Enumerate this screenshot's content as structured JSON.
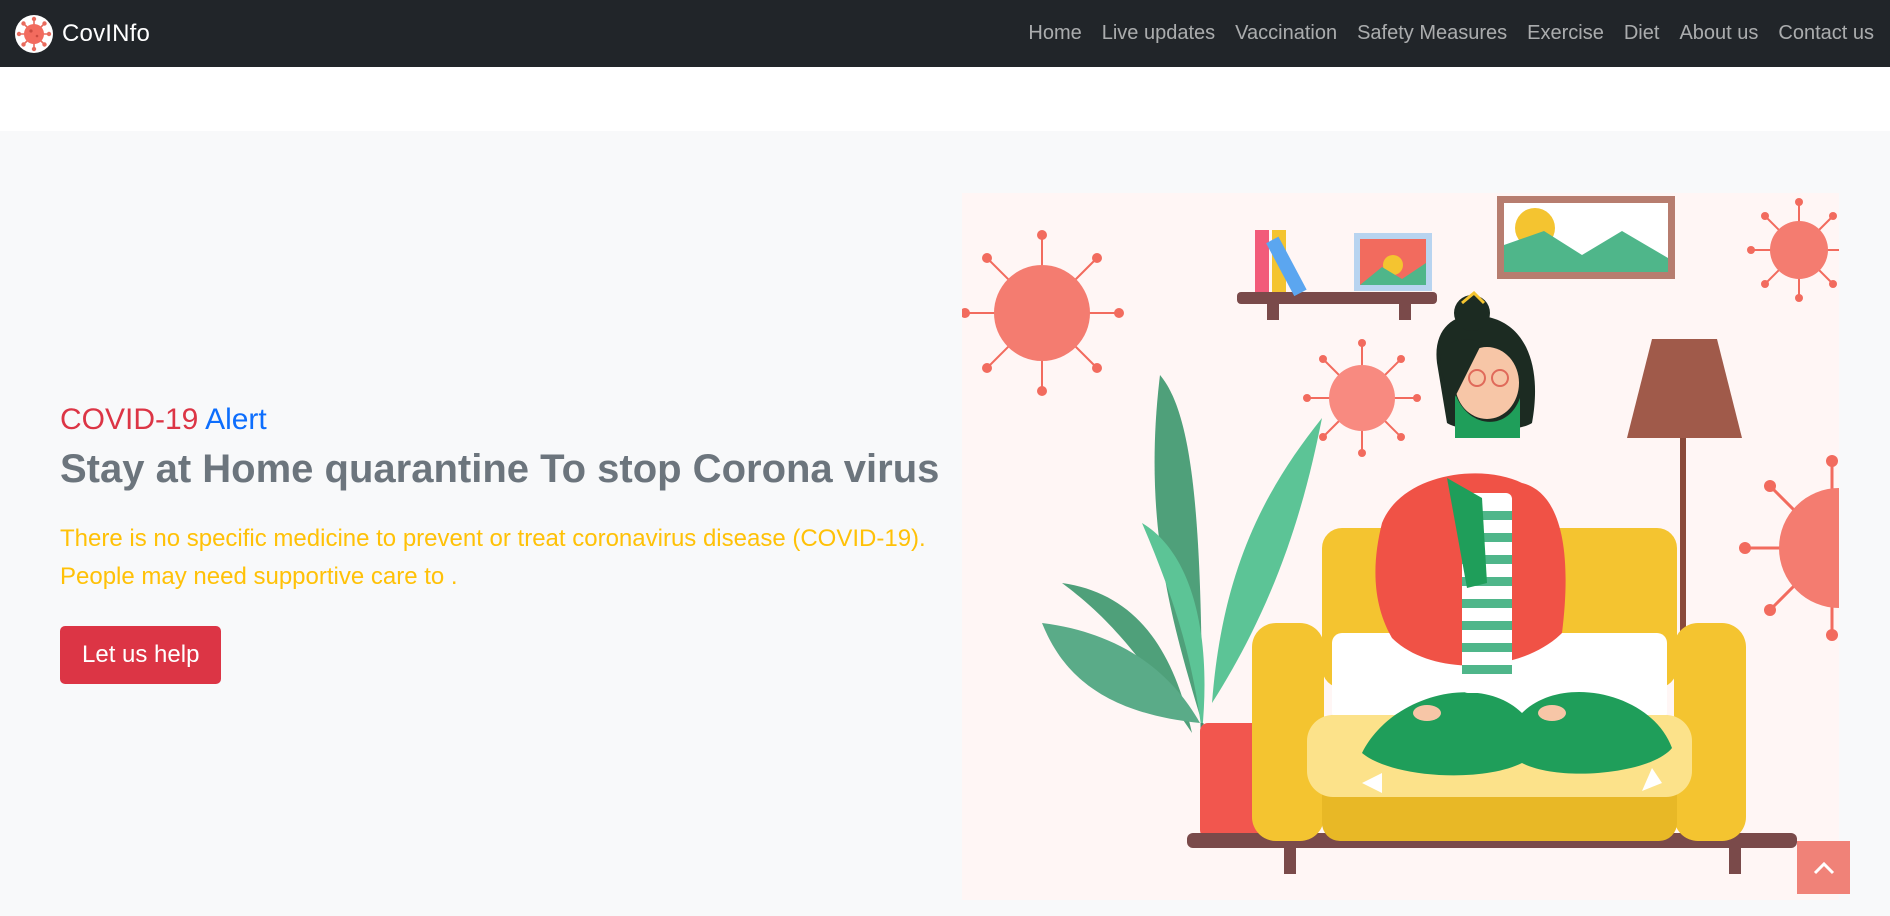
{
  "nav": {
    "brand": "CovINfo",
    "links": [
      "Home",
      "Live updates",
      "Vaccination",
      "Safety Measures",
      "Exercise",
      "Diet",
      "About us",
      "Contact us"
    ]
  },
  "hero": {
    "eyebrow_red": "COVID-19",
    "eyebrow_blue": "Alert",
    "headline": "Stay at Home quarantine To stop Corona virus",
    "lead_line1": "There is no specific medicine to prevent or treat coronavirus disease (COVID-19).",
    "lead_line2": "People may need supportive care to .",
    "cta": "Let us help"
  },
  "icons": {
    "brand": "virus-logo-icon",
    "back_to_top": "chevron-up-icon"
  },
  "colors": {
    "navbar": "#212529",
    "danger": "#dc3545",
    "primary": "#0d6efd",
    "warning": "#ffc107",
    "muted": "#6c757d",
    "hero_bg": "#f8f9fa",
    "back_to_top": "#f08278"
  }
}
